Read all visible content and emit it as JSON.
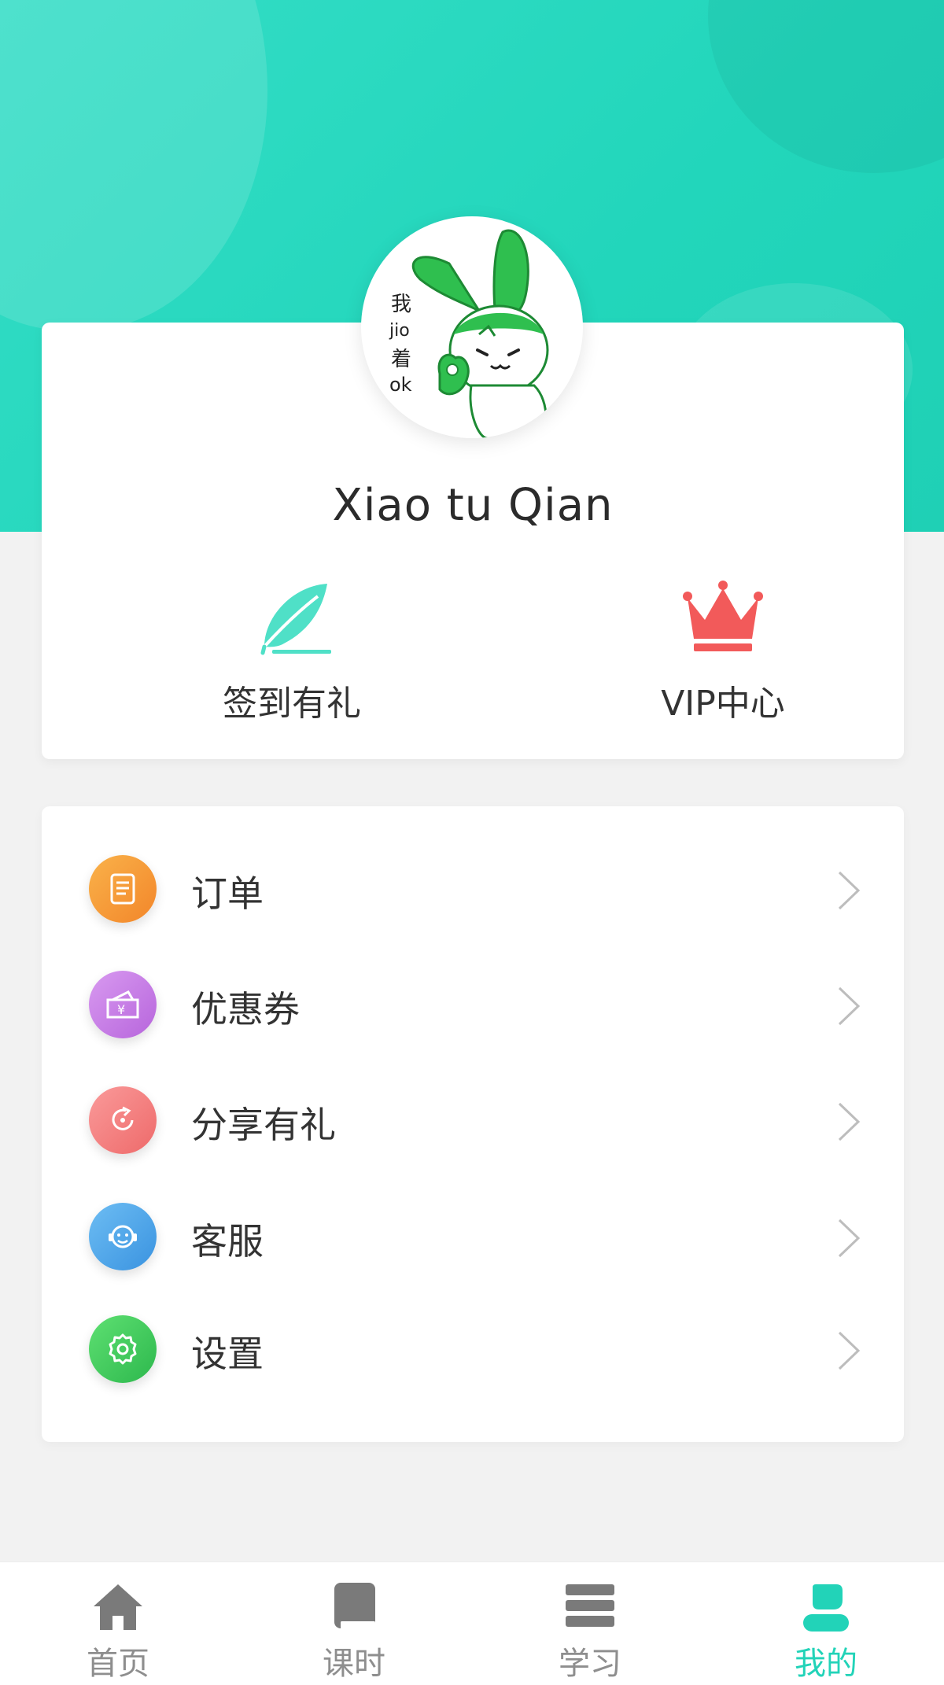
{
  "profile": {
    "name": "Xiao tu Qian",
    "avatar_icon": "bunny-ok-avatar",
    "avatar_text": [
      "我",
      "jio",
      "着",
      "ok"
    ]
  },
  "quick_actions": [
    {
      "label": "签到有礼",
      "icon": "feather-icon",
      "color": "#4fe0c7"
    },
    {
      "label": "VIP中心",
      "icon": "crown-icon",
      "color": "#f25a5a"
    }
  ],
  "menu": [
    {
      "label": "订单",
      "icon": "order-document-icon",
      "color": "#f59a2e"
    },
    {
      "label": "优惠券",
      "icon": "coupon-icon",
      "color": "#c67be6"
    },
    {
      "label": "分享有礼",
      "icon": "share-icon",
      "color": "#f47a7a"
    },
    {
      "label": "客服",
      "icon": "customer-service-icon",
      "color": "#49a6ea"
    },
    {
      "label": "设置",
      "icon": "settings-gear-icon",
      "color": "#3cc95a"
    }
  ],
  "tabs": [
    {
      "label": "首页",
      "icon": "home-icon",
      "active": false
    },
    {
      "label": "课时",
      "icon": "book-icon",
      "active": false
    },
    {
      "label": "学习",
      "icon": "stack-icon",
      "active": false
    },
    {
      "label": "我的",
      "icon": "user-icon",
      "active": true
    }
  ],
  "colors": {
    "accent": "#22d3b8",
    "background": "#f2f2f2",
    "card": "#ffffff"
  }
}
